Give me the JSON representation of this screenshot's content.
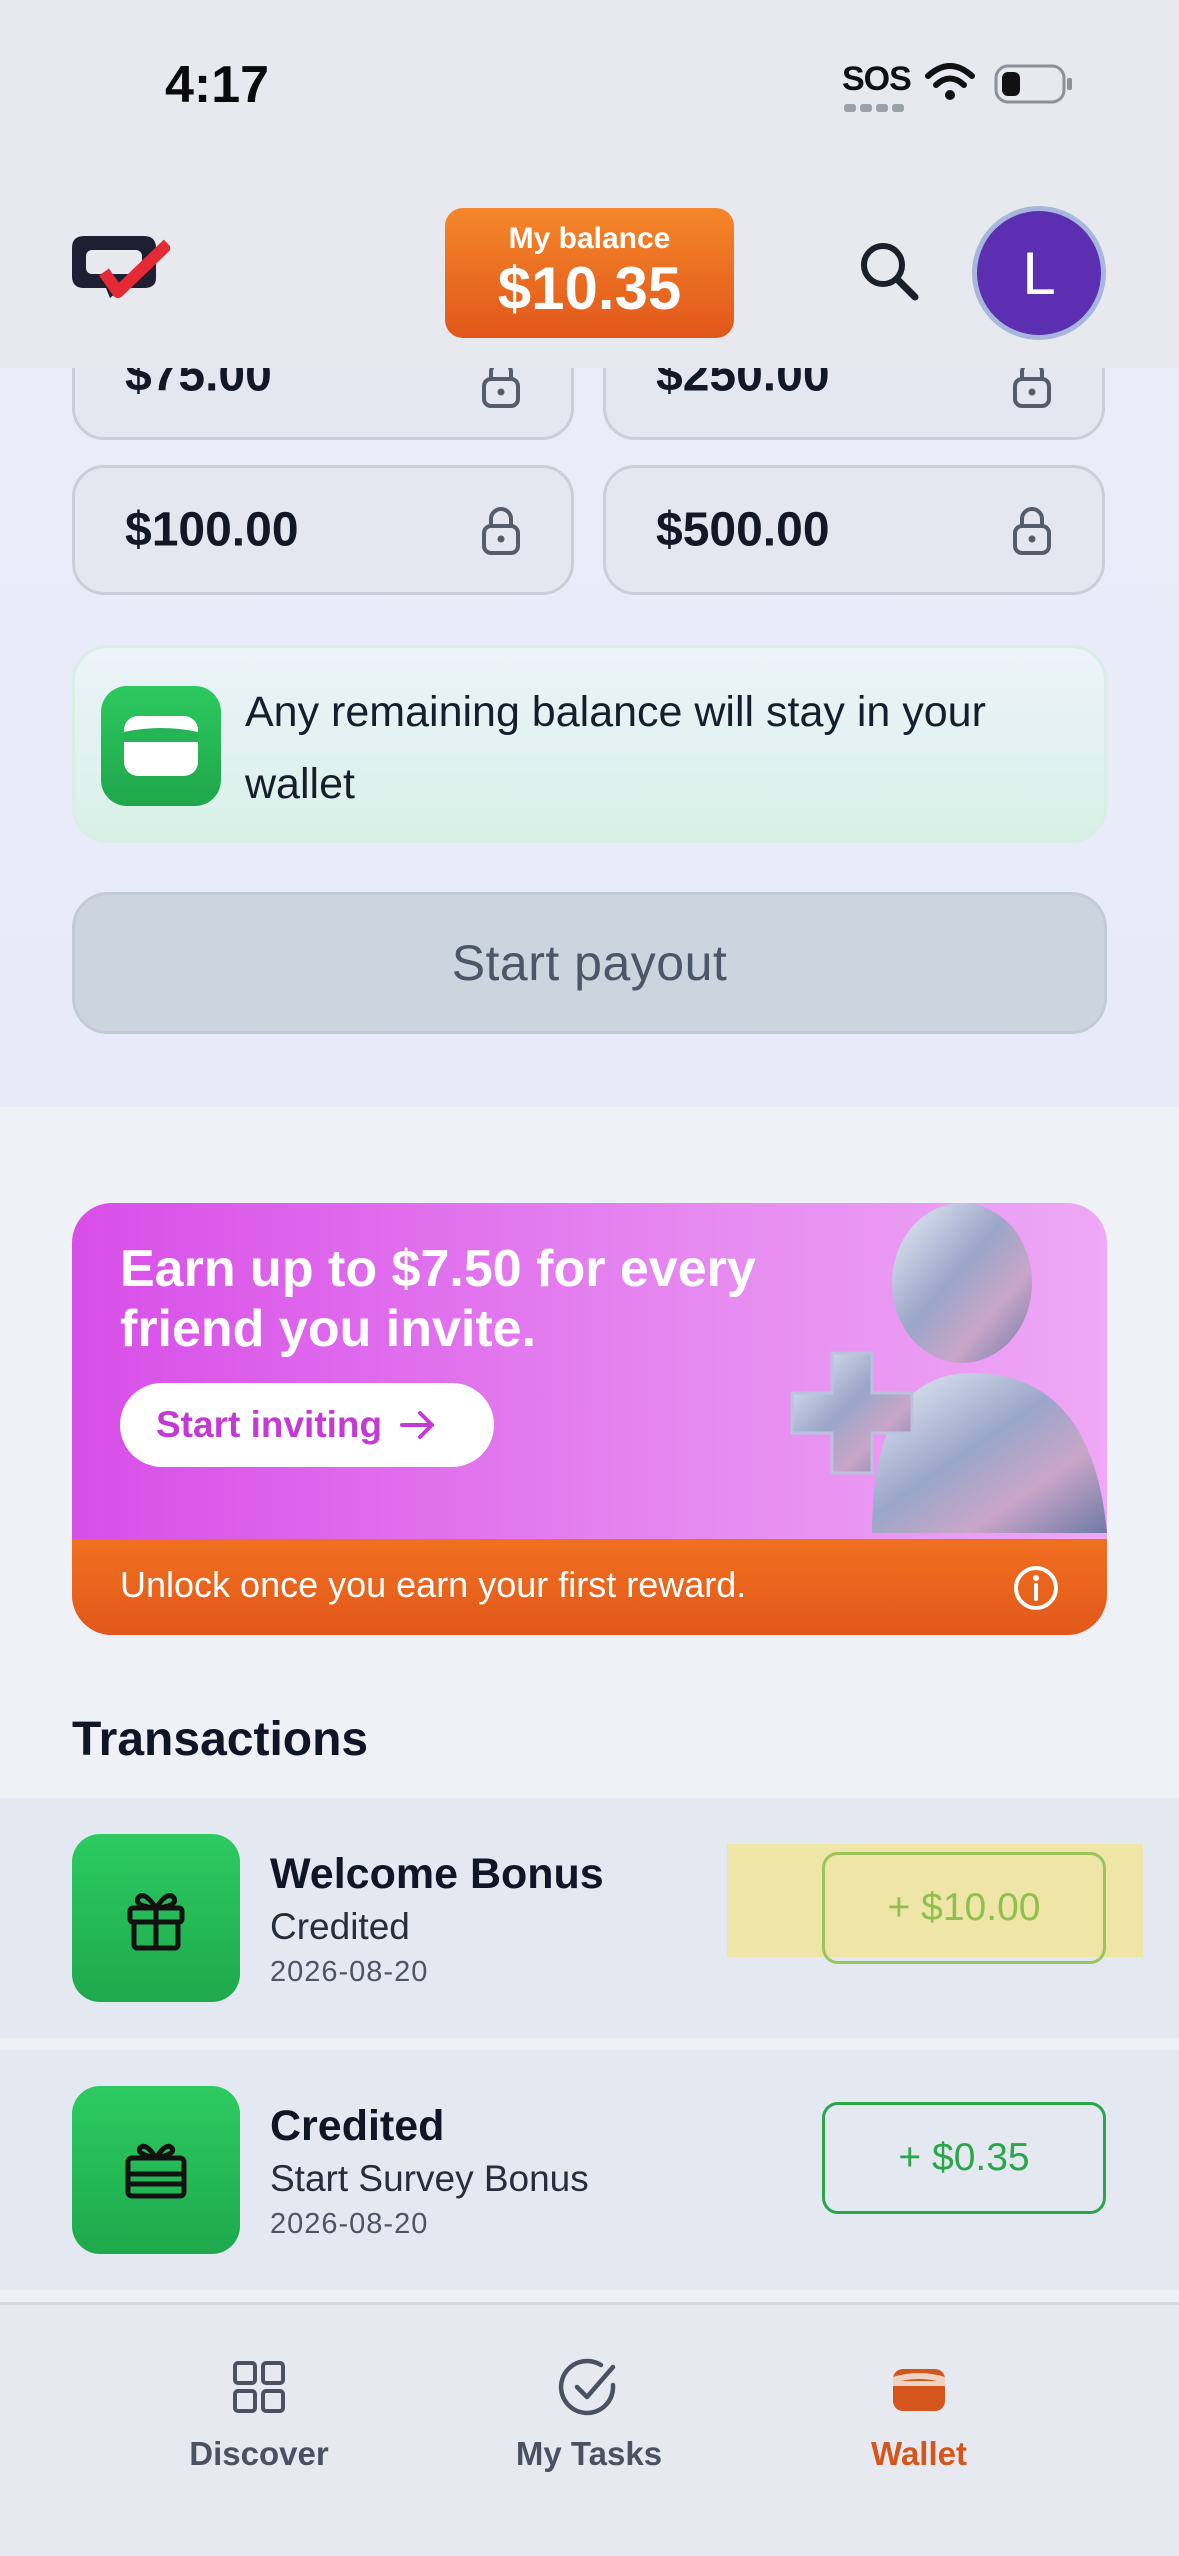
{
  "status_bar": {
    "time": "4:17",
    "sos": "SOS"
  },
  "header": {
    "balance_label": "My balance",
    "balance_value": "$10.35",
    "avatar_initial": "L"
  },
  "payout": {
    "amounts": [
      "$75.00",
      "$250.00",
      "$100.00",
      "$500.00"
    ],
    "info_text": "Any remaining balance will stay in your wallet",
    "start_button": "Start payout"
  },
  "promo": {
    "headline": "Earn up to $7.50 for every friend you invite.",
    "cta": "Start inviting",
    "footer": "Unlock once you earn your first reward."
  },
  "transactions": {
    "title": "Transactions",
    "items": [
      {
        "name": "Welcome Bonus",
        "subtitle": "Credited",
        "date": "2026-08-20",
        "amount": "+ $10.00"
      },
      {
        "name": "Credited",
        "subtitle": "Start Survey Bonus",
        "date": "2026-08-20",
        "amount": "+ $0.35"
      }
    ]
  },
  "nav": {
    "items": [
      {
        "label": "Discover",
        "icon": "grid-icon"
      },
      {
        "label": "My Tasks",
        "icon": "check-circle-icon"
      },
      {
        "label": "Wallet",
        "icon": "wallet-icon",
        "active": true
      }
    ]
  },
  "colors": {
    "accent_orange": "#e1571a",
    "promo_pink": "#d84ee8",
    "success_green": "#2aa64b",
    "avatar_purple": "#5b2fb0"
  }
}
